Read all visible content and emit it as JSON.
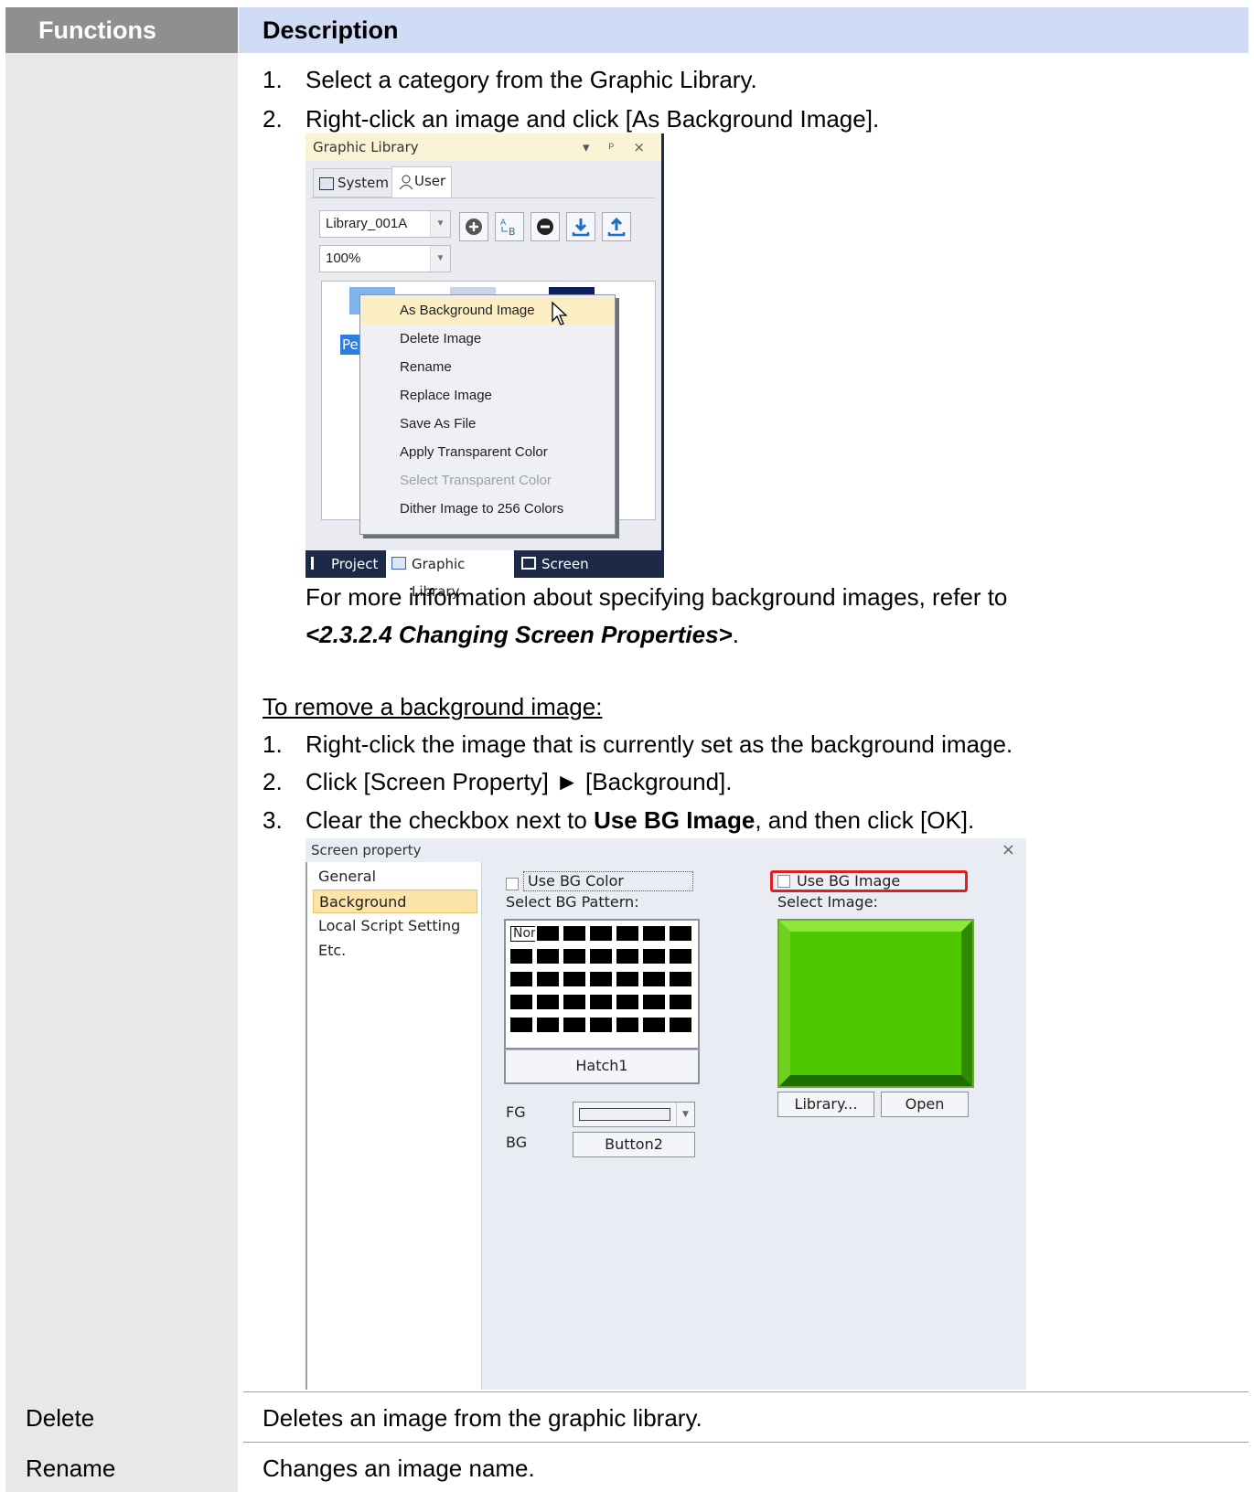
{
  "header": {
    "functions": "Functions",
    "description": "Description"
  },
  "background_row": {
    "steps": [
      {
        "n": "1.",
        "text": "Select a category from the Graphic Library."
      },
      {
        "n": "2.",
        "text": "Right-click an image and click [As Background Image]."
      }
    ],
    "more_info_prefix": "For more information about specifying background images, refer to",
    "more_info_ref": "<2.3.2.4 Changing Screen Properties>",
    "more_info_suffix": ".",
    "remove_heading": "To remove a background image:",
    "remove_steps": [
      {
        "n": "1.",
        "text": "Right-click the image that is currently set as the background image."
      },
      {
        "n": "2.",
        "text": "Click [Screen Property] ► [Background]."
      },
      {
        "n": "3.",
        "pre": "Clear the checkbox next to ",
        "bold": "Use BG Image",
        "post": ", and then click [OK]."
      }
    ]
  },
  "graphic_library": {
    "title": "Graphic Library",
    "title_buttons": "▾ ᵖ ×",
    "tabs": [
      "System",
      "User"
    ],
    "library_combo": "Library_001A",
    "zoom_combo": "100%",
    "thumb_label": "Pe",
    "context_menu": [
      {
        "label": "As Background Image",
        "state": "highlighted"
      },
      {
        "label": "Delete Image",
        "state": "normal"
      },
      {
        "label": "Rename",
        "state": "normal"
      },
      {
        "label": "Replace Image",
        "state": "normal"
      },
      {
        "label": "Save As File",
        "state": "normal"
      },
      {
        "label": "Apply Transparent Color",
        "state": "normal"
      },
      {
        "label": "Select Transparent Color",
        "state": "disabled"
      },
      {
        "label": "Dither Image to 256 Colors",
        "state": "normal"
      }
    ],
    "bottom_tabs": [
      "Project",
      "Graphic Library",
      "Screen"
    ]
  },
  "screen_property": {
    "title": "Screen property",
    "close": "×",
    "nav": [
      "General",
      "Background",
      "Local Script Setting",
      "Etc."
    ],
    "selected_nav": "Background",
    "use_bg_color": "Use BG Color",
    "select_bg_pattern": "Select BG Pattern:",
    "first_pattern": "Non",
    "pattern_name": "Hatch1",
    "fg_label": "FG",
    "bg_label": "BG",
    "bg_value": "Button2",
    "use_bg_image": "Use BG Image",
    "select_image": "Select Image:",
    "library_button": "Library...",
    "open_button": "Open",
    "highlight_color": "#e02020"
  },
  "functions": [
    {
      "name": "Delete",
      "description": "Deletes an image from the graphic library."
    },
    {
      "name": "Rename",
      "description": "Changes an image name."
    }
  ]
}
